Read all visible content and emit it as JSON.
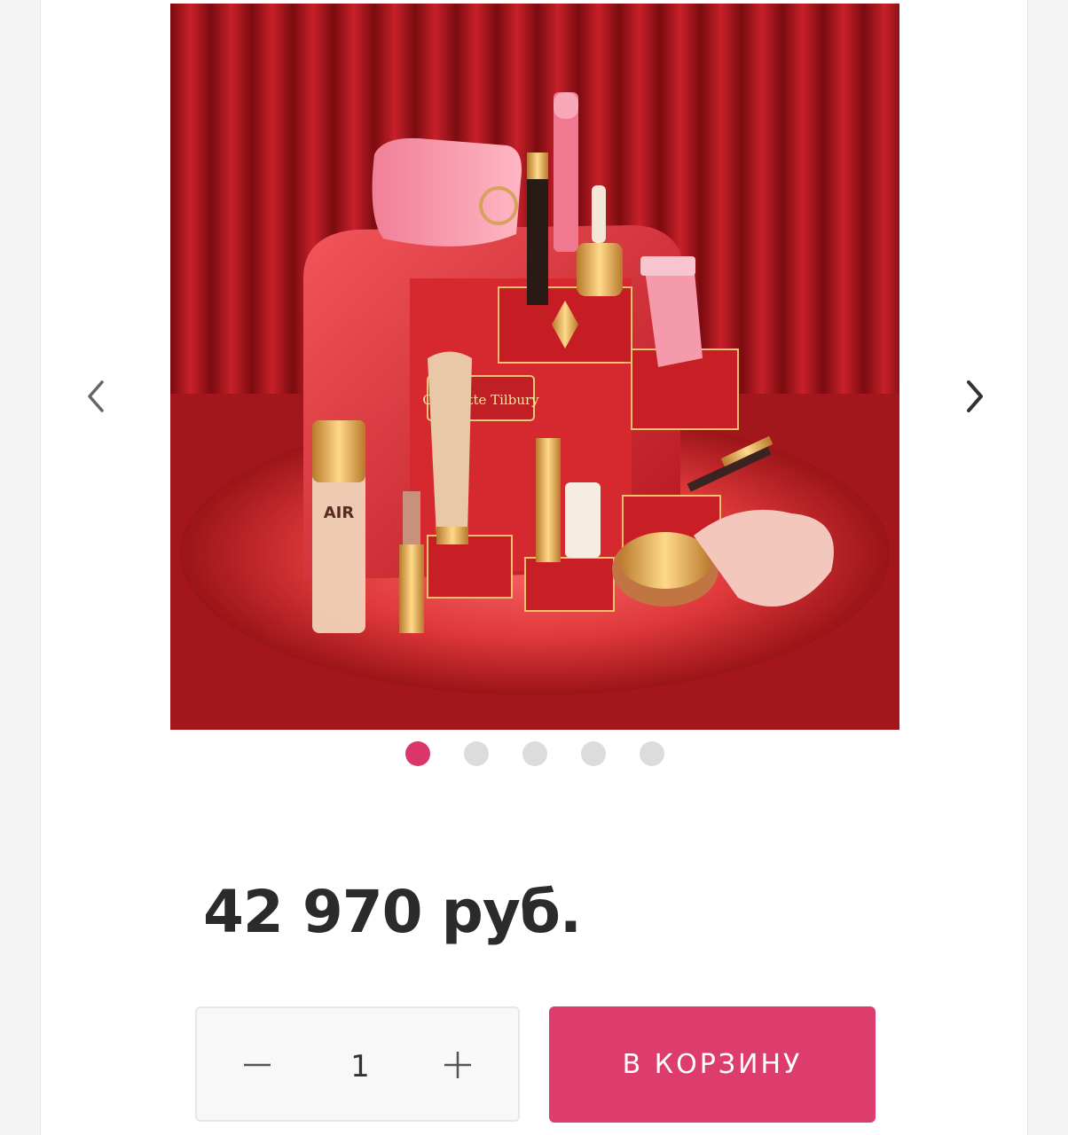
{
  "gallery": {
    "image_alt": "Charlotte Tilbury",
    "box_brand": "Charlotte Tilbury",
    "air_label": "AIR",
    "dot_count": 5,
    "active_index": 0,
    "colors": {
      "active_dot": "#d9366a",
      "inactive_dot": "#dcdcdc"
    }
  },
  "product": {
    "price": "42 970 руб."
  },
  "purchase": {
    "quantity": "1",
    "cart_label": "В КОРЗИНУ",
    "accent_color": "#dc3d6c"
  }
}
